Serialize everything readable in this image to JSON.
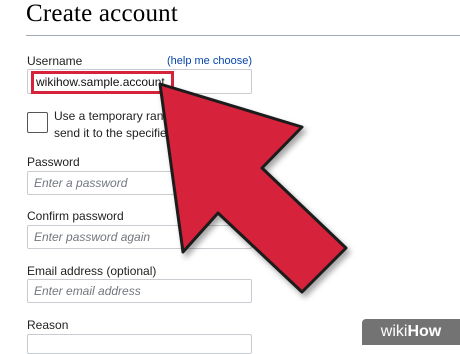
{
  "header": {
    "title": "Create account"
  },
  "form": {
    "username": {
      "label": "Username",
      "help_link": "(help me choose)",
      "value": "wikihow.sample.account"
    },
    "temp_password": {
      "line1": "Use a temporary rando",
      "line2": "send it to the specified e",
      "checked": false
    },
    "password": {
      "label": "Password",
      "placeholder": "Enter a password"
    },
    "confirm_password": {
      "label": "Confirm password",
      "placeholder": "Enter password again"
    },
    "email": {
      "label": "Email address (optional)",
      "placeholder": "Enter email address"
    },
    "reason": {
      "label": "Reason"
    }
  },
  "overlay": {
    "arrow_color": "#d6223a",
    "watermark_prefix": "wiki",
    "watermark_suffix": "How"
  }
}
